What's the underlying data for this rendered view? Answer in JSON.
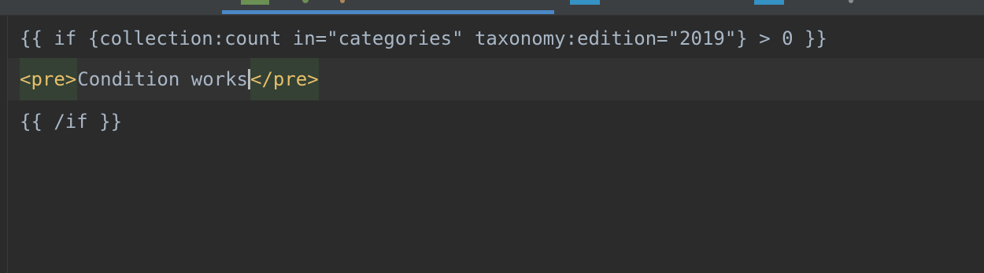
{
  "editor": {
    "lines": [
      "{{ if {collection:count in=\"categories\" taxonomy:edition=\"2019\"} > 0 }}",
      "",
      "{{ /if }}"
    ],
    "line2": {
      "open_tag": "<pre>",
      "text": "Condition works",
      "close_tag": "</pre>"
    }
  },
  "colors": {
    "background": "#2b2b2b",
    "current_line": "#323232",
    "tag_highlight": "#344134",
    "tag_color": "#e8bf6a",
    "text_color": "#a9b7c6",
    "tab_underline": "#4a88c7"
  }
}
